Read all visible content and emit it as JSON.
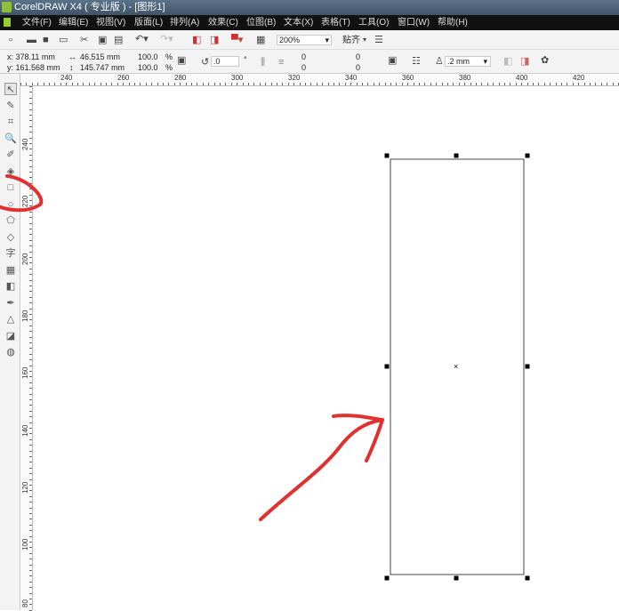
{
  "window": {
    "title": "CorelDRAW X4 ( 专业版 ) - [图形1]"
  },
  "menu": [
    "文件(F)",
    "编辑(E)",
    "视图(V)",
    "版面(L)",
    "排列(A)",
    "效果(C)",
    "位图(B)",
    "文本(X)",
    "表格(T)",
    "工具(O)",
    "窗口(W)",
    "帮助(H)"
  ],
  "toolbar": {
    "zoom": "200%",
    "snap": "贴齐"
  },
  "property_bar": {
    "x": "x: 378.11 mm",
    "y": "y: 161.568 mm",
    "width": "46.515 mm",
    "height": "145.747 mm",
    "scale_x": "100.0",
    "scale_y": "100.0",
    "percent": "%",
    "rotation": ".0",
    "degree": "°",
    "corner1": "0",
    "corner2": "0",
    "corner3": "0",
    "corner4": "0",
    "outline": ".2 mm"
  },
  "rulers": {
    "horizontal": [
      "240",
      "260",
      "280",
      "300",
      "320",
      "340",
      "360",
      "380",
      "400",
      "420"
    ],
    "vertical": [
      "240",
      "220",
      "200",
      "180",
      "160",
      "140",
      "120",
      "100",
      "80"
    ]
  },
  "toolbox": [
    "pick-tool",
    "shape-tool",
    "crop-tool",
    "zoom-tool",
    "freehand-tool",
    "smart-fill-tool",
    "rectangle-tool",
    "ellipse-tool",
    "polygon-tool",
    "basic-shapes-tool",
    "text-tool",
    "table-tool",
    "interactive-blend-tool",
    "eyedropper-tool",
    "outline-tool",
    "fill-tool",
    "interactive-fill-tool"
  ],
  "toolbox_glyphs": [
    "↖",
    "✎",
    "⌗",
    "🔍",
    "✐",
    "◈",
    "□",
    "○",
    "⬠",
    "◇",
    "字",
    "▦",
    "◧",
    "✒",
    "△",
    "◪",
    "◍"
  ],
  "colors": {
    "annotation": "#e03030",
    "menu_bg": "#111111"
  }
}
